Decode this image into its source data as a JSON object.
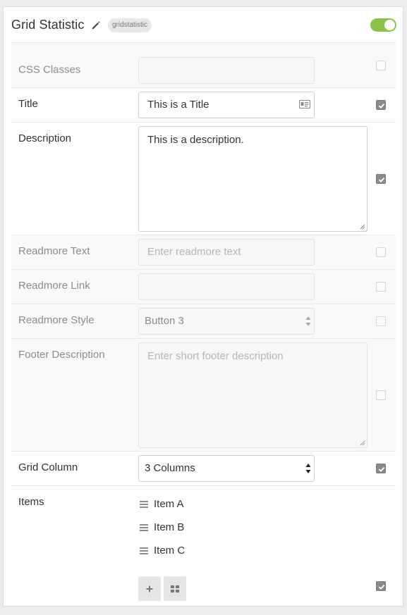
{
  "header": {
    "title": "Grid Statistic",
    "badge": "gridstatistic",
    "enabled": true,
    "accent_color": "#8bc34a"
  },
  "fields": {
    "css_classes": {
      "label": "CSS Classes",
      "value": "",
      "checked": false
    },
    "title": {
      "label": "Title",
      "value": "This is a Title",
      "checked": true
    },
    "description": {
      "label": "Description",
      "value": "This is a description.",
      "checked": true
    },
    "readmore_text": {
      "label": "Readmore Text",
      "placeholder": "Enter readmore text",
      "checked": false
    },
    "readmore_link": {
      "label": "Readmore Link",
      "value": "",
      "checked": false
    },
    "readmore_style": {
      "label": "Readmore Style",
      "value": "Button 3",
      "checked": false
    },
    "footer_description": {
      "label": "Footer Description",
      "placeholder": "Enter short footer description",
      "checked": false
    },
    "grid_column": {
      "label": "Grid Column",
      "value": "3 Columns",
      "checked": true
    },
    "items": {
      "label": "Items",
      "list": [
        "Item A",
        "Item B",
        "Item C"
      ],
      "checked": true
    }
  },
  "icons": {
    "edit": "pencil-icon",
    "title_field": "id-card-icon",
    "drag": "drag-handle-icon",
    "add": "plus-icon",
    "grid": "grid-icon"
  }
}
